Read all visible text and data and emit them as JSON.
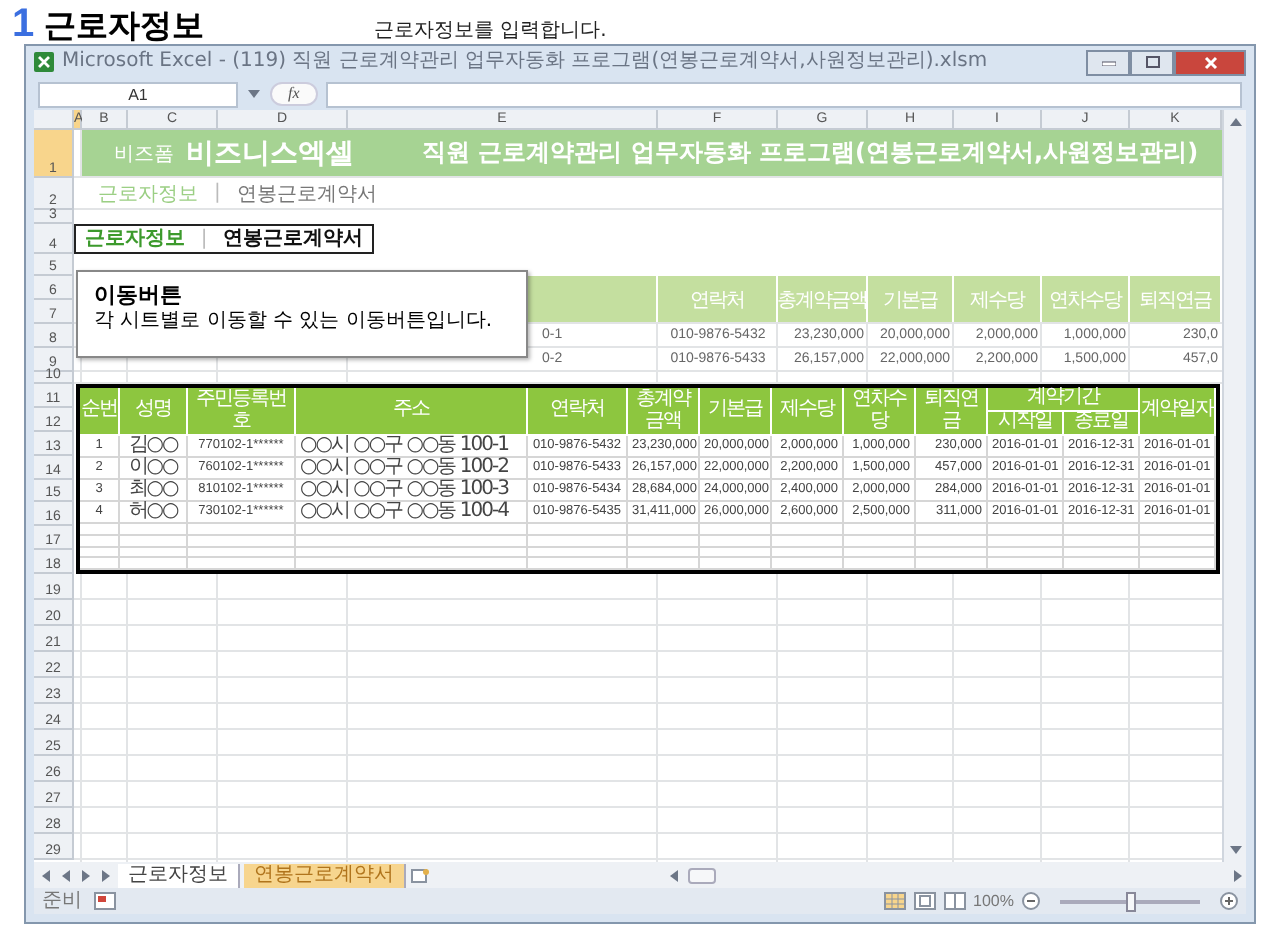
{
  "heading": {
    "number": "1",
    "title": "근로자정보",
    "description": "근로자정보를 입력합니다."
  },
  "window": {
    "title": "Microsoft Excel - (119) 직원 근로계약관리 업무자동화 프로그램(연봉근로계약서,사원정보관리).xlsm"
  },
  "formula_bar": {
    "name_box": "A1",
    "fx": "fx"
  },
  "columns": [
    {
      "label": "A",
      "selected": true
    },
    {
      "label": "B",
      "selected": false
    },
    {
      "label": "C",
      "selected": false
    },
    {
      "label": "D",
      "selected": false
    },
    {
      "label": "E",
      "selected": false
    },
    {
      "label": "F",
      "selected": false
    },
    {
      "label": "G",
      "selected": false
    },
    {
      "label": "H",
      "selected": false
    },
    {
      "label": "I",
      "selected": false
    },
    {
      "label": "J",
      "selected": false
    },
    {
      "label": "K",
      "selected": false
    }
  ],
  "row_headers": [
    {
      "label": "1",
      "selected": true
    },
    {
      "label": "2",
      "selected": false
    },
    {
      "label": "3",
      "selected": false
    },
    {
      "label": "4",
      "selected": false
    },
    {
      "label": "5",
      "selected": false
    },
    {
      "label": "6",
      "selected": false
    },
    {
      "label": "7",
      "selected": false
    },
    {
      "label": "8",
      "selected": false
    },
    {
      "label": "9",
      "selected": false
    },
    {
      "label": "10",
      "selected": false
    },
    {
      "label": "11",
      "selected": false
    },
    {
      "label": "12",
      "selected": false
    },
    {
      "label": "13",
      "selected": false
    },
    {
      "label": "14",
      "selected": false
    },
    {
      "label": "15",
      "selected": false
    },
    {
      "label": "16",
      "selected": false
    },
    {
      "label": "17",
      "selected": false
    },
    {
      "label": "18",
      "selected": false
    },
    {
      "label": "19",
      "selected": false
    },
    {
      "label": "20",
      "selected": false
    },
    {
      "label": "21",
      "selected": false
    },
    {
      "label": "22",
      "selected": false
    },
    {
      "label": "23",
      "selected": false
    },
    {
      "label": "24",
      "selected": false
    },
    {
      "label": "25",
      "selected": false
    },
    {
      "label": "26",
      "selected": false
    },
    {
      "label": "27",
      "selected": false
    },
    {
      "label": "28",
      "selected": false
    },
    {
      "label": "29",
      "selected": false
    }
  ],
  "banner": {
    "brand_small": "비즈폼",
    "brand": "비즈니스엑셀",
    "title": "직원 근로계약관리 업무자동화 프로그램(연봉근로계약서,사원정보관리)"
  },
  "top_nav": {
    "separator": "|",
    "items": [
      {
        "label": "근로자정보",
        "selected": true
      },
      {
        "label": "연봉근로계약서",
        "selected": false
      }
    ]
  },
  "nav_box": {
    "separator": "|",
    "items": [
      {
        "label": "근로자정보",
        "selected": true
      },
      {
        "label": "연봉근로계약서",
        "selected": false
      }
    ]
  },
  "callout": {
    "title": "이동버튼",
    "text": "각 시트별로 이동할 수 있는 이동버튼입니다."
  },
  "sheet_header": [
    "연락처",
    "총계약금액",
    "기본급",
    "제수당",
    "연차수당",
    "퇴직연금"
  ],
  "sheet_rows": [
    {
      "address_tail": "0-1",
      "cells": [
        "010-9876-5432",
        "23,230,000",
        "20,000,000",
        "2,000,000",
        "1,000,000",
        "230,0"
      ]
    },
    {
      "address_tail": "0-2",
      "cells": [
        "010-9876-5433",
        "26,157,000",
        "22,000,000",
        "2,200,000",
        "1,500,000",
        "457,0"
      ]
    }
  ],
  "table": {
    "columns": [
      "순번",
      "성명",
      "주민등록번호",
      "주소",
      "연락처",
      "총계약금액",
      "기본급",
      "제수당",
      "연차수당",
      "퇴직연금"
    ],
    "period": {
      "label": "계약기간",
      "start": "시작일",
      "end": "종료일"
    },
    "last_column": "계약일자",
    "rows": [
      [
        "1",
        "김○○",
        "770102-1******",
        "○○시 ○○구 ○○동 100-1",
        "010-9876-5432",
        "23,230,000",
        "20,000,000",
        "2,000,000",
        "1,000,000",
        "230,000",
        "2016-01-01",
        "2016-12-31",
        "2016-01-01"
      ],
      [
        "2",
        "이○○",
        "760102-1******",
        "○○시 ○○구 ○○동 100-2",
        "010-9876-5433",
        "26,157,000",
        "22,000,000",
        "2,200,000",
        "1,500,000",
        "457,000",
        "2016-01-01",
        "2016-12-31",
        "2016-01-01"
      ],
      [
        "3",
        "최○○",
        "810102-1******",
        "○○시 ○○구 ○○동 100-3",
        "010-9876-5434",
        "28,684,000",
        "24,000,000",
        "2,400,000",
        "2,000,000",
        "284,000",
        "2016-01-01",
        "2016-12-31",
        "2016-01-01"
      ],
      [
        "4",
        "허○○",
        "730102-1******",
        "○○시 ○○구 ○○동 100-4",
        "010-9876-5435",
        "31,411,000",
        "26,000,000",
        "2,600,000",
        "2,500,000",
        "311,000",
        "2016-01-01",
        "2016-12-31",
        "2016-01-01"
      ]
    ]
  },
  "sheet_tabs": [
    {
      "label": "근로자정보",
      "selected": true
    },
    {
      "label": "연봉근로계약서",
      "selected": false,
      "color": "#f7d58e"
    }
  ],
  "status_bar": {
    "status": "준비",
    "zoom": "100%",
    "zoom_slider": {
      "level": 0.5
    }
  }
}
